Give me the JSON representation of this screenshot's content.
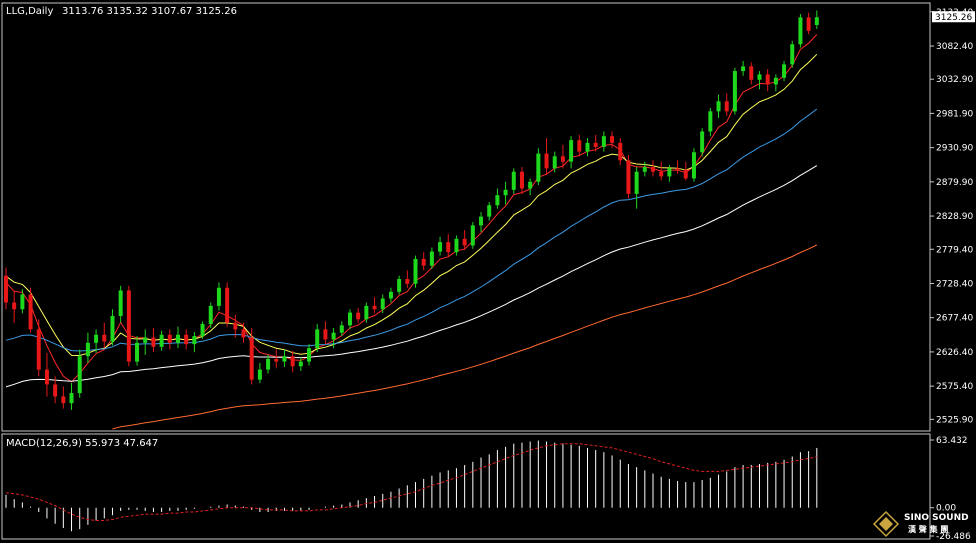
{
  "chart_data": {
    "type": "candlestick",
    "symbol_label": "LLG,Daily",
    "ohlc_label": "3113.76 3135.32 3107.67 3125.26",
    "current_price_label": "3125.26",
    "main_ylim": [
      2510,
      3145
    ],
    "price_ticks": [
      "3133.40",
      "3082.40",
      "3032.90",
      "2981.90",
      "2930.90",
      "2879.90",
      "2828.90",
      "2779.40",
      "2728.40",
      "2677.40",
      "2626.40",
      "2575.40",
      "2525.90"
    ],
    "candles": [
      [
        2740,
        2752,
        2690,
        2700
      ],
      [
        2700,
        2718,
        2670,
        2690
      ],
      [
        2690,
        2720,
        2684,
        2712
      ],
      [
        2712,
        2722,
        2655,
        2660
      ],
      [
        2660,
        2675,
        2590,
        2600
      ],
      [
        2600,
        2625,
        2560,
        2578
      ],
      [
        2578,
        2590,
        2550,
        2560
      ],
      [
        2560,
        2575,
        2542,
        2550
      ],
      [
        2550,
        2580,
        2540,
        2565
      ],
      [
        2565,
        2630,
        2558,
        2620
      ],
      [
        2620,
        2655,
        2610,
        2640
      ],
      [
        2640,
        2660,
        2625,
        2652
      ],
      [
        2652,
        2670,
        2632,
        2642
      ],
      [
        2642,
        2690,
        2636,
        2680
      ],
      [
        2680,
        2725,
        2670,
        2718
      ],
      [
        2718,
        2725,
        2605,
        2612
      ],
      [
        2612,
        2650,
        2606,
        2640
      ],
      [
        2640,
        2660,
        2622,
        2648
      ],
      [
        2648,
        2662,
        2626,
        2634
      ],
      [
        2634,
        2658,
        2628,
        2652
      ],
      [
        2652,
        2660,
        2630,
        2640
      ],
      [
        2640,
        2664,
        2632,
        2652
      ],
      [
        2652,
        2660,
        2630,
        2638
      ],
      [
        2638,
        2656,
        2626,
        2650
      ],
      [
        2650,
        2672,
        2646,
        2668
      ],
      [
        2668,
        2700,
        2662,
        2695
      ],
      [
        2695,
        2730,
        2688,
        2722
      ],
      [
        2722,
        2730,
        2664,
        2670
      ],
      [
        2670,
        2682,
        2648,
        2660
      ],
      [
        2660,
        2670,
        2640,
        2648
      ],
      [
        2648,
        2662,
        2578,
        2585
      ],
      [
        2585,
        2610,
        2580,
        2600
      ],
      [
        2600,
        2622,
        2594,
        2616
      ],
      [
        2616,
        2630,
        2602,
        2612
      ],
      [
        2612,
        2630,
        2604,
        2620
      ],
      [
        2620,
        2628,
        2596,
        2605
      ],
      [
        2605,
        2618,
        2598,
        2612
      ],
      [
        2612,
        2638,
        2606,
        2632
      ],
      [
        2632,
        2668,
        2626,
        2660
      ],
      [
        2660,
        2672,
        2638,
        2645
      ],
      [
        2645,
        2662,
        2632,
        2655
      ],
      [
        2655,
        2672,
        2650,
        2666
      ],
      [
        2666,
        2690,
        2660,
        2685
      ],
      [
        2685,
        2692,
        2670,
        2675
      ],
      [
        2675,
        2700,
        2670,
        2695
      ],
      [
        2695,
        2708,
        2684,
        2690
      ],
      [
        2690,
        2712,
        2684,
        2706
      ],
      [
        2706,
        2722,
        2700,
        2716
      ],
      [
        2716,
        2740,
        2712,
        2735
      ],
      [
        2735,
        2748,
        2722,
        2728
      ],
      [
        2728,
        2770,
        2722,
        2765
      ],
      [
        2765,
        2775,
        2748,
        2755
      ],
      [
        2755,
        2782,
        2750,
        2776
      ],
      [
        2776,
        2798,
        2770,
        2790
      ],
      [
        2790,
        2802,
        2768,
        2775
      ],
      [
        2775,
        2800,
        2770,
        2795
      ],
      [
        2795,
        2808,
        2778,
        2785
      ],
      [
        2785,
        2820,
        2780,
        2815
      ],
      [
        2815,
        2835,
        2805,
        2828
      ],
      [
        2828,
        2850,
        2822,
        2845
      ],
      [
        2845,
        2870,
        2840,
        2860
      ],
      [
        2860,
        2880,
        2846,
        2868
      ],
      [
        2868,
        2900,
        2862,
        2895
      ],
      [
        2895,
        2902,
        2862,
        2870
      ],
      [
        2870,
        2885,
        2860,
        2880
      ],
      [
        2880,
        2930,
        2875,
        2922
      ],
      [
        2922,
        2945,
        2890,
        2900
      ],
      [
        2900,
        2925,
        2894,
        2918
      ],
      [
        2918,
        2935,
        2900,
        2910
      ],
      [
        2910,
        2948,
        2900,
        2942
      ],
      [
        2942,
        2950,
        2918,
        2925
      ],
      [
        2925,
        2945,
        2918,
        2938
      ],
      [
        2938,
        2950,
        2925,
        2932
      ],
      [
        2932,
        2955,
        2925,
        2948
      ],
      [
        2948,
        2955,
        2930,
        2938
      ],
      [
        2938,
        2945,
        2905,
        2912
      ],
      [
        2912,
        2920,
        2855,
        2862
      ],
      [
        2862,
        2902,
        2840,
        2895
      ],
      [
        2895,
        2910,
        2888,
        2902
      ],
      [
        2902,
        2912,
        2888,
        2895
      ],
      [
        2895,
        2910,
        2882,
        2888
      ],
      [
        2888,
        2905,
        2880,
        2900
      ],
      [
        2900,
        2912,
        2892,
        2898
      ],
      [
        2898,
        2910,
        2882,
        2885
      ],
      [
        2885,
        2930,
        2880,
        2924
      ],
      [
        2924,
        2960,
        2918,
        2955
      ],
      [
        2955,
        2990,
        2948,
        2985
      ],
      [
        2985,
        3010,
        2975,
        3000
      ],
      [
        3000,
        3012,
        2978,
        2985
      ],
      [
        2985,
        3050,
        2980,
        3045
      ],
      [
        3045,
        3060,
        3038,
        3052
      ],
      [
        3052,
        3058,
        3025,
        3032
      ],
      [
        3032,
        3045,
        3018,
        3040
      ],
      [
        3040,
        3048,
        3015,
        3025
      ],
      [
        3025,
        3040,
        3015,
        3035
      ],
      [
        3035,
        3060,
        3030,
        3055
      ],
      [
        3055,
        3090,
        3050,
        3085
      ],
      [
        3085,
        3130,
        3080,
        3125
      ],
      [
        3125,
        3132,
        3100,
        3105
      ],
      [
        3113.76,
        3135.32,
        3107.67,
        3125.26
      ]
    ],
    "ma_colors": [
      "#ff2a2a",
      "#ffff5a",
      "#3b9be6",
      "#ffffff",
      "#ff6a30"
    ],
    "macd": {
      "label": "MACD(12,26,9) 55.973 47.647",
      "ylim": [
        -26.486,
        63.432
      ],
      "ticks": [
        "63.432",
        "0.00",
        "-26.486"
      ],
      "hist": [
        12,
        8,
        5,
        1,
        -4,
        -10,
        -15,
        -19,
        -22,
        -20,
        -16,
        -12,
        -10,
        -7,
        -3,
        -2,
        -2,
        -3,
        -4,
        -4,
        -3,
        -3,
        -2,
        -1,
        0,
        1,
        2,
        3,
        2,
        1,
        -2,
        -4,
        -4,
        -3,
        -3,
        -3,
        -3,
        -2,
        0,
        1,
        2,
        3,
        5,
        7,
        9,
        11,
        13,
        15,
        18,
        21,
        24,
        27,
        30,
        33,
        35,
        37,
        40,
        43,
        47,
        50,
        54,
        57,
        60,
        61,
        62,
        63,
        62,
        61,
        60,
        59,
        58,
        56,
        54,
        52,
        49,
        45,
        41,
        38,
        35,
        32,
        29,
        27,
        25,
        24,
        24,
        26,
        28,
        31,
        34,
        38,
        40,
        40,
        41,
        42,
        43,
        45,
        48,
        52,
        53,
        56
      ],
      "signal": [
        14,
        13,
        12,
        10,
        8,
        5,
        2,
        -2,
        -6,
        -9,
        -11,
        -12,
        -12,
        -11,
        -9,
        -8,
        -7,
        -6,
        -6,
        -6,
        -5,
        -5,
        -4,
        -4,
        -3,
        -2,
        -1,
        0,
        0,
        0,
        0,
        -1,
        -2,
        -2,
        -2,
        -3,
        -3,
        -3,
        -2,
        -2,
        -1,
        0,
        1,
        2,
        4,
        5,
        7,
        9,
        11,
        13,
        15,
        18,
        21,
        23,
        26,
        28,
        31,
        34,
        37,
        40,
        43,
        46,
        49,
        51,
        54,
        56,
        58,
        59,
        60,
        60,
        60,
        59,
        58,
        57,
        56,
        54,
        52,
        50,
        48,
        46,
        43,
        41,
        39,
        37,
        35,
        34,
        34,
        34,
        35,
        36,
        37,
        38,
        39,
        40,
        41,
        42,
        43,
        45,
        46,
        47.647
      ]
    }
  },
  "watermark": {
    "line1": "SINO SOUND",
    "line2": "漢 聲 集 團"
  }
}
